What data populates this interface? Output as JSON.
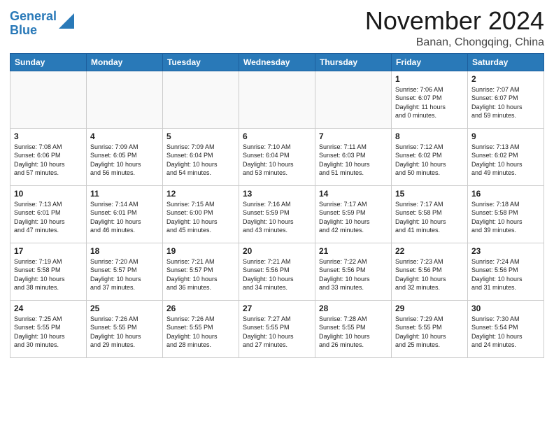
{
  "header": {
    "logo_line1": "General",
    "logo_line2": "Blue",
    "month_title": "November 2024",
    "location": "Banan, Chongqing, China"
  },
  "calendar": {
    "days_of_week": [
      "Sunday",
      "Monday",
      "Tuesday",
      "Wednesday",
      "Thursday",
      "Friday",
      "Saturday"
    ],
    "weeks": [
      [
        {
          "day": "",
          "info": ""
        },
        {
          "day": "",
          "info": ""
        },
        {
          "day": "",
          "info": ""
        },
        {
          "day": "",
          "info": ""
        },
        {
          "day": "",
          "info": ""
        },
        {
          "day": "1",
          "info": "Sunrise: 7:06 AM\nSunset: 6:07 PM\nDaylight: 11 hours\nand 0 minutes."
        },
        {
          "day": "2",
          "info": "Sunrise: 7:07 AM\nSunset: 6:07 PM\nDaylight: 10 hours\nand 59 minutes."
        }
      ],
      [
        {
          "day": "3",
          "info": "Sunrise: 7:08 AM\nSunset: 6:06 PM\nDaylight: 10 hours\nand 57 minutes."
        },
        {
          "day": "4",
          "info": "Sunrise: 7:09 AM\nSunset: 6:05 PM\nDaylight: 10 hours\nand 56 minutes."
        },
        {
          "day": "5",
          "info": "Sunrise: 7:09 AM\nSunset: 6:04 PM\nDaylight: 10 hours\nand 54 minutes."
        },
        {
          "day": "6",
          "info": "Sunrise: 7:10 AM\nSunset: 6:04 PM\nDaylight: 10 hours\nand 53 minutes."
        },
        {
          "day": "7",
          "info": "Sunrise: 7:11 AM\nSunset: 6:03 PM\nDaylight: 10 hours\nand 51 minutes."
        },
        {
          "day": "8",
          "info": "Sunrise: 7:12 AM\nSunset: 6:02 PM\nDaylight: 10 hours\nand 50 minutes."
        },
        {
          "day": "9",
          "info": "Sunrise: 7:13 AM\nSunset: 6:02 PM\nDaylight: 10 hours\nand 49 minutes."
        }
      ],
      [
        {
          "day": "10",
          "info": "Sunrise: 7:13 AM\nSunset: 6:01 PM\nDaylight: 10 hours\nand 47 minutes."
        },
        {
          "day": "11",
          "info": "Sunrise: 7:14 AM\nSunset: 6:01 PM\nDaylight: 10 hours\nand 46 minutes."
        },
        {
          "day": "12",
          "info": "Sunrise: 7:15 AM\nSunset: 6:00 PM\nDaylight: 10 hours\nand 45 minutes."
        },
        {
          "day": "13",
          "info": "Sunrise: 7:16 AM\nSunset: 5:59 PM\nDaylight: 10 hours\nand 43 minutes."
        },
        {
          "day": "14",
          "info": "Sunrise: 7:17 AM\nSunset: 5:59 PM\nDaylight: 10 hours\nand 42 minutes."
        },
        {
          "day": "15",
          "info": "Sunrise: 7:17 AM\nSunset: 5:58 PM\nDaylight: 10 hours\nand 41 minutes."
        },
        {
          "day": "16",
          "info": "Sunrise: 7:18 AM\nSunset: 5:58 PM\nDaylight: 10 hours\nand 39 minutes."
        }
      ],
      [
        {
          "day": "17",
          "info": "Sunrise: 7:19 AM\nSunset: 5:58 PM\nDaylight: 10 hours\nand 38 minutes."
        },
        {
          "day": "18",
          "info": "Sunrise: 7:20 AM\nSunset: 5:57 PM\nDaylight: 10 hours\nand 37 minutes."
        },
        {
          "day": "19",
          "info": "Sunrise: 7:21 AM\nSunset: 5:57 PM\nDaylight: 10 hours\nand 36 minutes."
        },
        {
          "day": "20",
          "info": "Sunrise: 7:21 AM\nSunset: 5:56 PM\nDaylight: 10 hours\nand 34 minutes."
        },
        {
          "day": "21",
          "info": "Sunrise: 7:22 AM\nSunset: 5:56 PM\nDaylight: 10 hours\nand 33 minutes."
        },
        {
          "day": "22",
          "info": "Sunrise: 7:23 AM\nSunset: 5:56 PM\nDaylight: 10 hours\nand 32 minutes."
        },
        {
          "day": "23",
          "info": "Sunrise: 7:24 AM\nSunset: 5:56 PM\nDaylight: 10 hours\nand 31 minutes."
        }
      ],
      [
        {
          "day": "24",
          "info": "Sunrise: 7:25 AM\nSunset: 5:55 PM\nDaylight: 10 hours\nand 30 minutes."
        },
        {
          "day": "25",
          "info": "Sunrise: 7:26 AM\nSunset: 5:55 PM\nDaylight: 10 hours\nand 29 minutes."
        },
        {
          "day": "26",
          "info": "Sunrise: 7:26 AM\nSunset: 5:55 PM\nDaylight: 10 hours\nand 28 minutes."
        },
        {
          "day": "27",
          "info": "Sunrise: 7:27 AM\nSunset: 5:55 PM\nDaylight: 10 hours\nand 27 minutes."
        },
        {
          "day": "28",
          "info": "Sunrise: 7:28 AM\nSunset: 5:55 PM\nDaylight: 10 hours\nand 26 minutes."
        },
        {
          "day": "29",
          "info": "Sunrise: 7:29 AM\nSunset: 5:55 PM\nDaylight: 10 hours\nand 25 minutes."
        },
        {
          "day": "30",
          "info": "Sunrise: 7:30 AM\nSunset: 5:54 PM\nDaylight: 10 hours\nand 24 minutes."
        }
      ]
    ]
  }
}
